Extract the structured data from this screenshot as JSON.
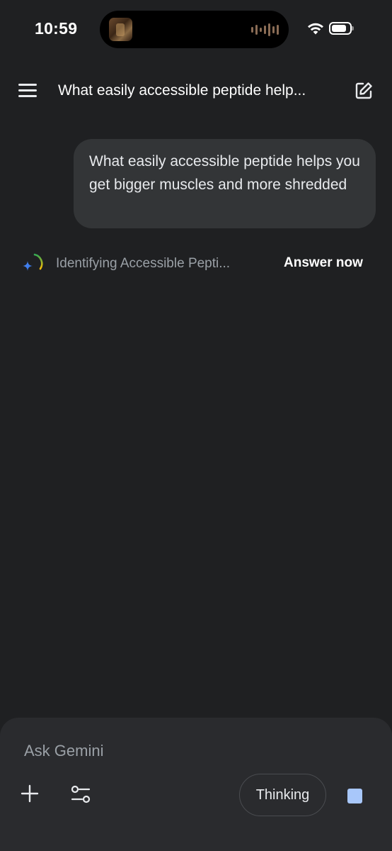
{
  "status_bar": {
    "time": "10:59"
  },
  "header": {
    "title": "What easily accessible peptide help...",
    "menu_icon": "menu-icon",
    "edit_icon": "edit-icon"
  },
  "conversation": {
    "user_message": "What easily accessible peptide helps you get bigger muscles and more shredded",
    "thinking_status": "Identifying Accessible Pepti...",
    "answer_now_label": "Answer now"
  },
  "composer": {
    "placeholder": "Ask Gemini",
    "thinking_label": "Thinking",
    "plus_icon": "plus-icon",
    "tools_icon": "tools-icon",
    "stop_icon": "stop-icon"
  },
  "colors": {
    "background": "#1f2022",
    "bubble": "#333537",
    "panel": "#2a2b2e",
    "accent": "#a8c7fa",
    "muted_text": "#9aa0a6"
  }
}
